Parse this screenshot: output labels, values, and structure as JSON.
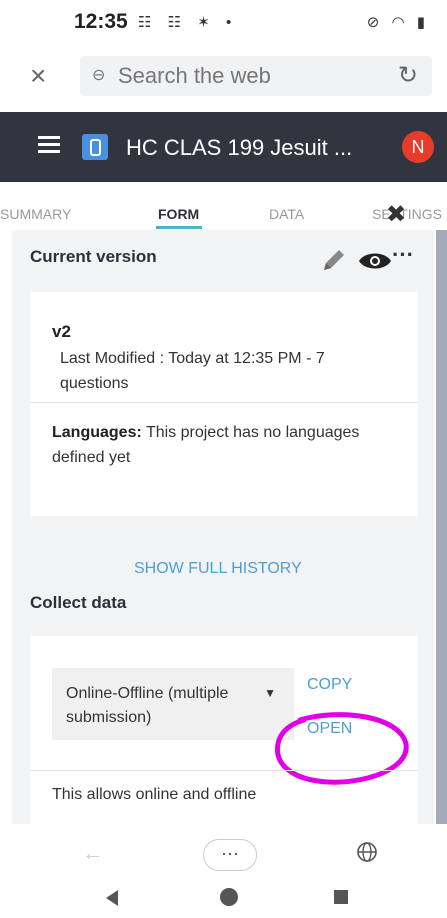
{
  "status": {
    "time": "12:35",
    "left_icons": "☷ ☷ ✶ •",
    "right_icons": "⊘ ◠ ▮"
  },
  "browser": {
    "close_glyph": "×",
    "search_placeholder": "Search the web",
    "lock_glyph": "⊖",
    "reload_glyph": "↻"
  },
  "header": {
    "title": "HC CLAS 199 Jesuit ...",
    "avatar_letter": "N"
  },
  "tabs": [
    {
      "label": "SUMMARY"
    },
    {
      "label": "FORM"
    },
    {
      "label": "DATA"
    },
    {
      "label": "SETTINGS"
    }
  ],
  "tab_close_glyph": "✖",
  "version_section": {
    "title": "Current version",
    "more_glyph": "···",
    "name": "v2",
    "meta": "Last Modified : Today at 12:35 PM - 7 questions",
    "languages_label": "Languages:",
    "languages_text": " This project has no languages defined yet"
  },
  "history_link": "SHOW FULL HISTORY",
  "collect_section": {
    "title": "Collect data",
    "select_value": "Online-Offline (multiple submission)",
    "select_arrow": "▼",
    "copy_label": "COPY",
    "open_label": "OPEN",
    "description": "This allows online and offline"
  },
  "bottom": {
    "back_glyph": "←",
    "menu_glyph": "···"
  },
  "colors": {
    "header_bg": "#30353f",
    "accent": "#4ab5c6",
    "link": "#4a9fd6",
    "avatar": "#e83b2a",
    "annotation": "#e100e6"
  }
}
